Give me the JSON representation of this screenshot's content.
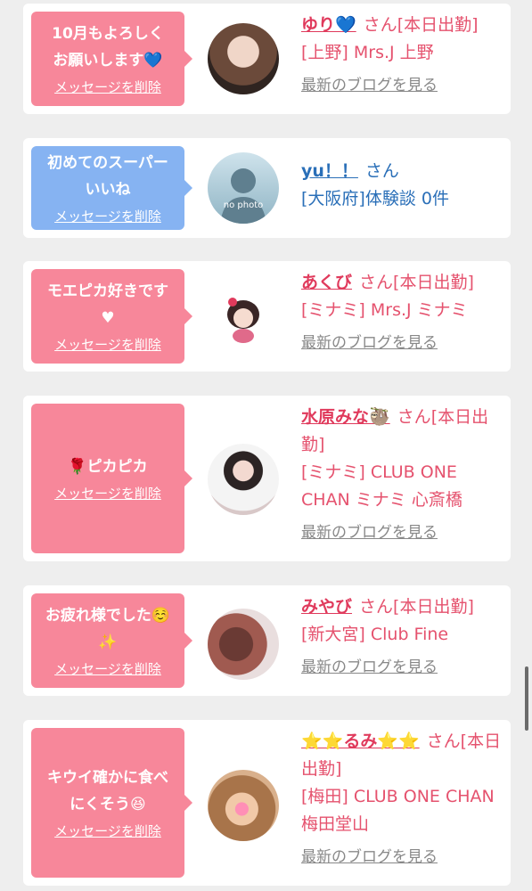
{
  "cards": [
    {
      "bubble_color": "#f7879a",
      "message": "10月もよろしく\nお願いします💙",
      "delete_label": "メッセージを削除",
      "name": "ゆり💙",
      "san": "さん",
      "status": "[本日出勤]",
      "shop": "[上野] Mrs.J 上野",
      "blog_link": "最新のブログを見る"
    },
    {
      "bubble_color": "#86b3f2",
      "message": "初めてのスーパー\nいいね",
      "delete_label": "メッセージを削除",
      "name": "yu！！",
      "san": "さん",
      "status": "",
      "shop": "[大阪府]体験談 0件",
      "avatar_text": "no photo"
    },
    {
      "bubble_color": "#f7879a",
      "message": "モエピカ好きです\n♥",
      "delete_label": "メッセージを削除",
      "name": "あくび",
      "san": "さん",
      "status": "[本日出勤]",
      "shop": "[ミナミ] Mrs.J ミナミ",
      "blog_link": "最新のブログを見る"
    },
    {
      "bubble_color": "#f7879a",
      "message": "🌹ピカピカ",
      "delete_label": "メッセージを削除",
      "name": "水原みな🦥",
      "san": "さん",
      "status": "[本日出勤]",
      "shop": "[ミナミ] CLUB ONE CHAN ミナミ 心斎橋",
      "blog_link": "最新のブログを見る"
    },
    {
      "bubble_color": "#f7879a",
      "message": "お疲れ様でした☺️\n✨",
      "delete_label": "メッセージを削除",
      "name": "みやび",
      "san": "さん",
      "status": "[本日出勤]",
      "shop": "[新大宮] Club Fine",
      "blog_link": "最新のブログを見る"
    },
    {
      "bubble_color": "#f7879a",
      "message": "キウイ確かに食べ\nにくそう😆",
      "delete_label": "メッセージを削除",
      "name": "⭐⭐るみ⭐⭐",
      "san": "さん",
      "status": "[本日出勤]",
      "shop": "[梅田] CLUB ONE CHAN 梅田堂山",
      "blog_link": "最新のブログを見る"
    }
  ]
}
